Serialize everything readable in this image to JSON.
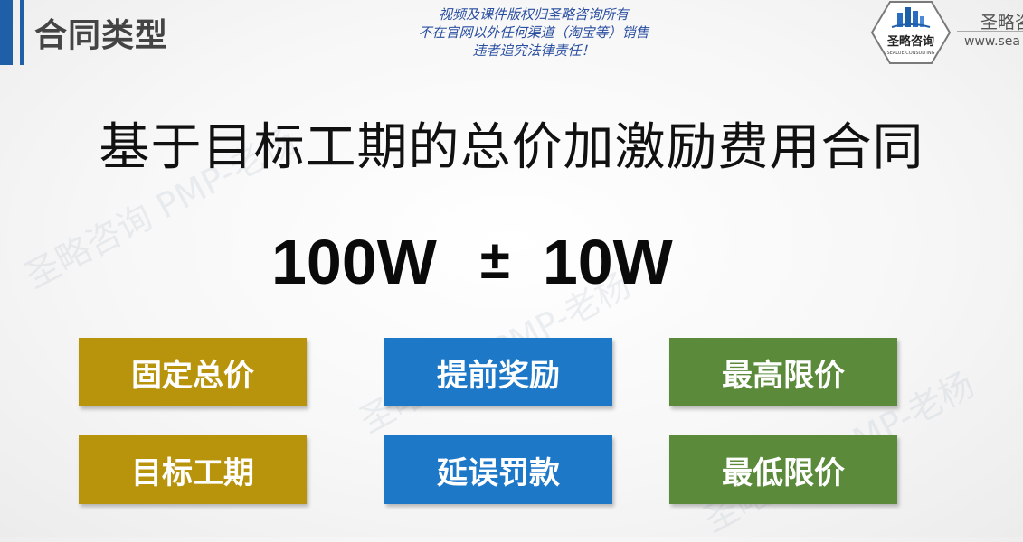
{
  "header": {
    "title": "合同类型",
    "copyright_lines": [
      "视频及课件版权归圣略咨询所有",
      "不在官网以外任何渠道（淘宝等）销售",
      "违者追究法律责任！"
    ],
    "logo_text": "圣略咨询",
    "logo_subtext": "SEALUE CONSULTING",
    "brand_name": "圣略咨",
    "brand_url": "www.sea"
  },
  "watermark": "圣略咨询 PMP-老杨",
  "main": {
    "title": "基于目标工期的总价加激励费用合同",
    "formula": {
      "base": "100W",
      "operator": "±",
      "range": "10W"
    }
  },
  "boxes": [
    {
      "label": "固定总价",
      "color": "#b8940d"
    },
    {
      "label": "提前奖励",
      "color": "#1e78c8"
    },
    {
      "label": "最高限价",
      "color": "#5a8a3a"
    },
    {
      "label": "目标工期",
      "color": "#b8940d"
    },
    {
      "label": "延误罚款",
      "color": "#1e78c8"
    },
    {
      "label": "最低限价",
      "color": "#5a8a3a"
    }
  ]
}
